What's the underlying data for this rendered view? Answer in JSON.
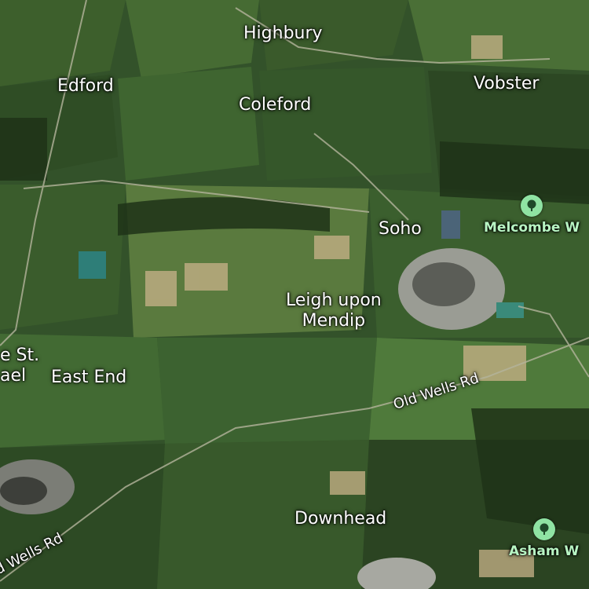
{
  "towns": {
    "highbury": "Highbury",
    "edford": "Edford",
    "coleford": "Coleford",
    "vobster": "Vobster",
    "soho": "Soho",
    "leigh_line1": "Leigh upon",
    "leigh_line2": "Mendip",
    "east_end": "East End",
    "west_partial_1": "e St.",
    "west_partial_2": "ael",
    "downhead": "Downhead"
  },
  "roads": {
    "old_wells_rd_east": "Old Wells Rd",
    "old_wells_rd_west": "d Wells Rd"
  },
  "pois": {
    "melcombe": {
      "label": "Melcombe W",
      "icon": "tree-icon"
    },
    "asham": {
      "label": "Asham W",
      "icon": "tree-icon"
    }
  },
  "colors": {
    "poi_text": "#b8f5c3",
    "poi_icon_bg": "#8fe3a3",
    "label_text": "#ffffff"
  }
}
